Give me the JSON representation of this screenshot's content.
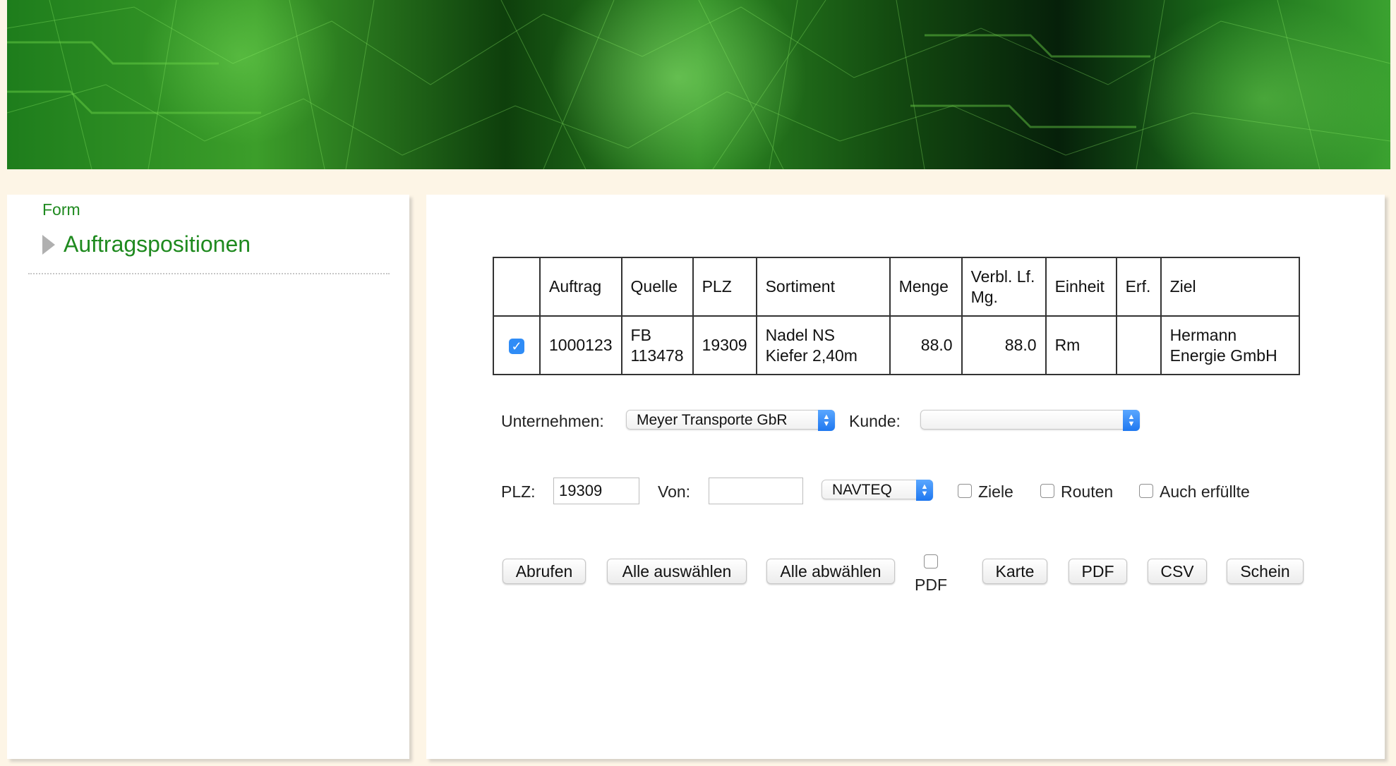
{
  "sidebar": {
    "breadcrumb": "Form",
    "nav_item": "Auftragspositionen"
  },
  "table": {
    "headers": [
      "",
      "Auftrag",
      "Quelle",
      "PLZ",
      "Sortiment",
      "Menge",
      "Verbl. Lf. Mg.",
      "Einheit",
      "Erf.",
      "Ziel"
    ],
    "rows": [
      {
        "checked": true,
        "auftrag": "1000123",
        "quelle": "FB 113478",
        "plz": "19309",
        "sortiment": "Nadel NS Kiefer 2,40m",
        "menge": "88.0",
        "verbl": "88.0",
        "einheit": "Rm",
        "erf": "",
        "ziel": "Hermann Energie GmbH"
      }
    ]
  },
  "form": {
    "unternehmen_label": "Unternehmen:",
    "unternehmen_value": "Meyer Transporte GbR",
    "kunde_label": "Kunde:",
    "kunde_value": "",
    "plz_label": "PLZ:",
    "plz_value": "19309",
    "von_label": "Von:",
    "von_value": "",
    "provider_value": "NAVTEQ",
    "ziele_label": "Ziele",
    "routen_label": "Routen",
    "auch_label": "Auch erfüllte"
  },
  "buttons": {
    "abrufen": "Abrufen",
    "alle_auswaehlen": "Alle auswählen",
    "alle_abwaehlen": "Alle abwählen",
    "pdf_check_label": "PDF",
    "karte": "Karte",
    "pdf": "PDF",
    "csv": "CSV",
    "schein": "Schein"
  },
  "colors": {
    "accent_green": "#1f8a1f",
    "page_background": "#fdf5e6",
    "select_arrow_blue": "#1f78f0"
  },
  "icons": {
    "nav_arrow": "triangle-right-icon",
    "select_arrows": "up-down-arrows-icon",
    "checkmark": "checkmark-icon"
  }
}
